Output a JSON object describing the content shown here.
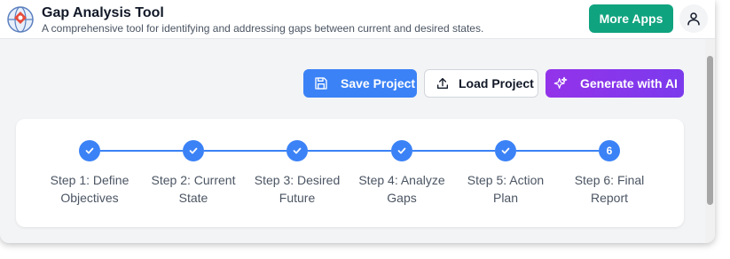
{
  "header": {
    "title": "Gap Analysis Tool",
    "subtitle": "A comprehensive tool for identifying and addressing gaps between current and desired states.",
    "more_apps_label": "More Apps",
    "logo_icon": "globe-logo-icon",
    "user_icon": "user-icon"
  },
  "toolbar": {
    "save_label": "Save Project",
    "save_icon": "floppy-disk-icon",
    "load_label": "Load Project",
    "load_icon": "upload-icon",
    "ai_label": "Generate with AI",
    "ai_icon": "sparkles-icon"
  },
  "stepper": {
    "steps": [
      {
        "label": "Step 1: Define Objectives",
        "status": "completed",
        "number": "1"
      },
      {
        "label": "Step 2: Current State",
        "status": "completed",
        "number": "2"
      },
      {
        "label": "Step 3: Desired Future",
        "status": "completed",
        "number": "3"
      },
      {
        "label": "Step 4: Analyze Gaps",
        "status": "completed",
        "number": "4"
      },
      {
        "label": "Step 5: Action Plan",
        "status": "completed",
        "number": "5"
      },
      {
        "label": "Step 6: Final Report",
        "status": "current",
        "number": "6"
      }
    ]
  },
  "colors": {
    "primary": "#3b82f6",
    "more_apps": "#10a37f",
    "ai_gradient_start": "#9333ea",
    "ai_gradient_end": "#7c3aed"
  }
}
